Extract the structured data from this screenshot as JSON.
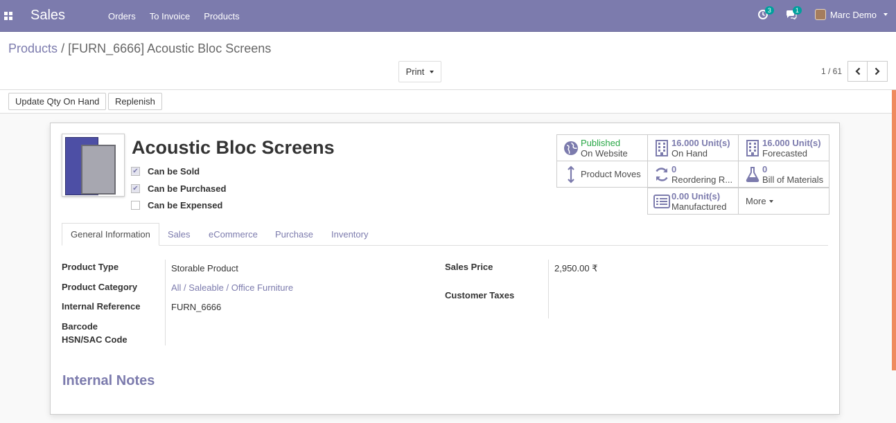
{
  "topnav": {
    "app_name": "Sales",
    "menu": [
      "Orders",
      "To Invoice",
      "Products"
    ],
    "activity_count": "3",
    "message_count": "1",
    "user_name": "Marc Demo"
  },
  "breadcrumb": {
    "parent": "Products",
    "separator": "/",
    "current": "[FURN_6666] Acoustic Bloc Screens"
  },
  "control": {
    "print_label": "Print",
    "pager_value": "1 / 61"
  },
  "statusbar": {
    "update_qty_label": "Update Qty On Hand",
    "replenish_label": "Replenish"
  },
  "product": {
    "name": "Acoustic Bloc Screens",
    "can_be_sold_label": "Can be Sold",
    "can_be_sold": true,
    "can_be_purchased_label": "Can be Purchased",
    "can_be_purchased": true,
    "can_be_expensed_label": "Can be Expensed",
    "can_be_expensed": false
  },
  "smart_buttons": {
    "published_status": "Published",
    "published_label": "On Website",
    "on_hand_value": "16.000 Unit(s)",
    "on_hand_label": "On Hand",
    "forecasted_value": "16.000 Unit(s)",
    "forecasted_label": "Forecasted",
    "product_moves_label": "Product Moves",
    "reordering_value": "0",
    "reordering_label": "Reordering R...",
    "bom_value": "0",
    "bom_label": "Bill of Materials",
    "manufactured_value": "0.00 Unit(s)",
    "manufactured_label": "Manufactured",
    "more_label": "More"
  },
  "tabs": [
    "General Information",
    "Sales",
    "eCommerce",
    "Purchase",
    "Inventory"
  ],
  "general_info": {
    "product_type_label": "Product Type",
    "product_type": "Storable Product",
    "product_category_label": "Product Category",
    "product_category": "All / Saleable / Office Furniture",
    "internal_reference_label": "Internal Reference",
    "internal_reference": "FURN_6666",
    "barcode_label": "Barcode",
    "hsn_label": "HSN/SAC Code",
    "sales_price_label": "Sales Price",
    "sales_price": "2,950.00 ₹",
    "customer_taxes_label": "Customer Taxes"
  },
  "notes_title": "Internal Notes",
  "colors": {
    "brand": "#7c7bad",
    "published": "#28a745",
    "badge": "#00a09d"
  }
}
